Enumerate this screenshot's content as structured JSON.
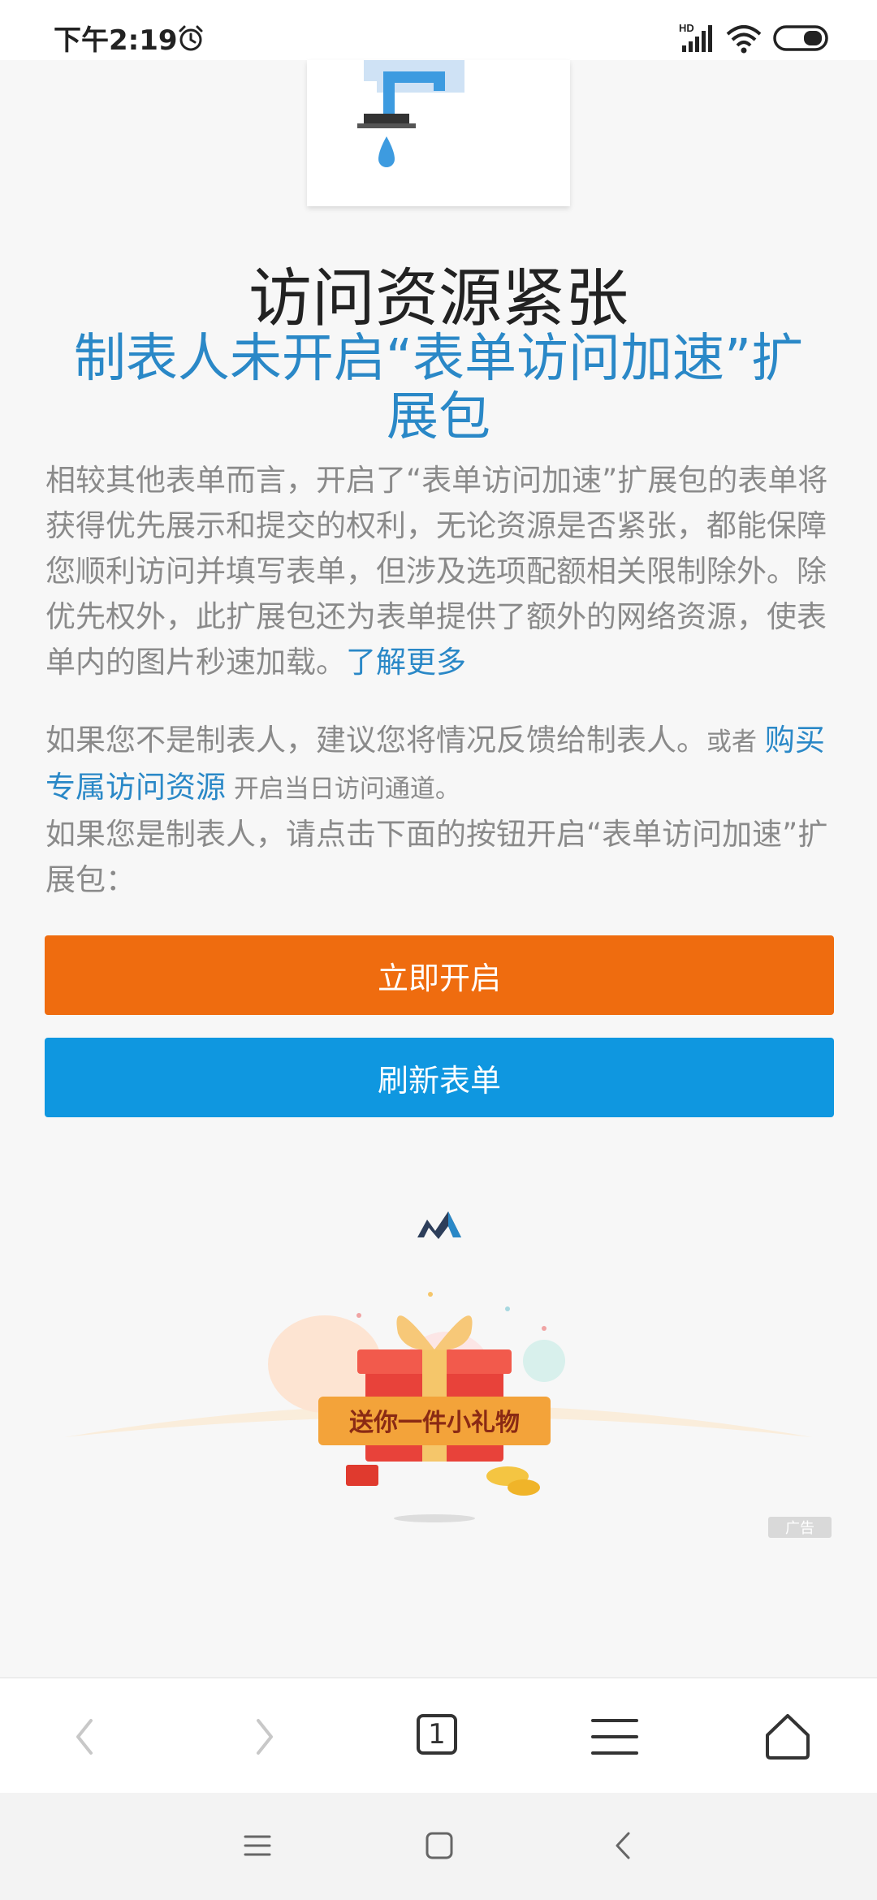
{
  "status_bar": {
    "time": "下午2:19"
  },
  "page": {
    "title": "访问资源紧张",
    "subtitle": "制表人未开启“表单访问加速”扩展包",
    "description": "相较其他表单而言，开启了“表单访问加速”扩展包的表单将获得优先展示和提交的权利，无论资源是否紧张，都能保障您顺利访问并填写表单，但涉及选项配额相关限制除外。除优先权外，此扩展包还为表单提供了额外的网络资源，使表单内的图片秒速加载。",
    "learn_more": "了解更多",
    "non_owner_text": "如果您不是制表人，建议您将情况反馈给制表人。",
    "or_text": "或者 ",
    "buy_link": "购买专属访问资源",
    "open_channel_text": " 开启当日访问通道。",
    "owner_text": "如果您是制表人，请点击下面的按钮开启“表单访问加速”扩展包："
  },
  "buttons": {
    "open_now": "立即开启",
    "refresh_form": "刷新表单"
  },
  "ad": {
    "banner_text": "送你一件小礼物",
    "badge": "广告"
  },
  "browser_toolbar": {
    "tab_count": "1"
  },
  "colors": {
    "accent_blue": "#2a88c7",
    "orange_button": "#ef6c0f",
    "blue_button": "#0f97e0"
  }
}
